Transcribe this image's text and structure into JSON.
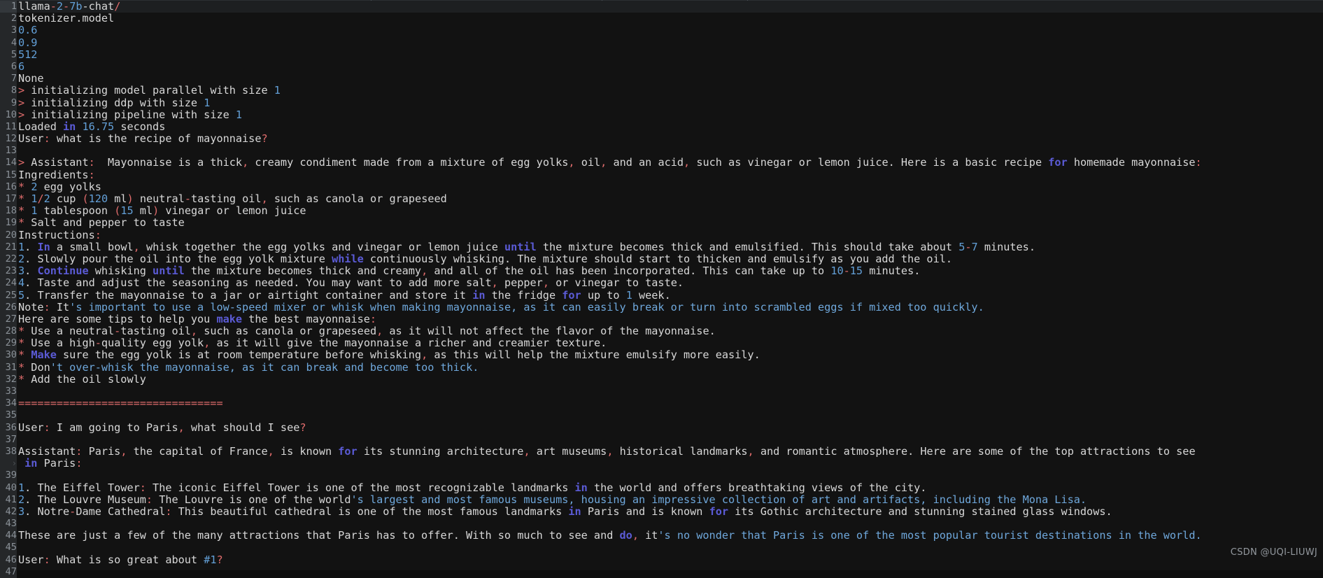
{
  "window": {
    "title": "terminal-output",
    "background_color": "#121212",
    "gutter_color": "#252729",
    "current_line_color": "#1d1f21"
  },
  "colors": {
    "default_text": "#d8d8d8",
    "number": "#63a0d8",
    "string": "#6fa8dc",
    "keyword": "#5b5bd6",
    "operator": "#e06c6c",
    "line_number": "#8b9299"
  },
  "watermark": {
    "text": "CSDN @UQI-LIUWJ"
  },
  "lines": [
    {
      "n": "1",
      "current": true,
      "tokens": [
        {
          "t": "llama",
          "c": "def"
        },
        {
          "t": "-",
          "c": "op"
        },
        {
          "t": "2",
          "c": "num"
        },
        {
          "t": "-",
          "c": "op"
        },
        {
          "t": "7b",
          "c": "num"
        },
        {
          "t": "-chat",
          "c": "def"
        },
        {
          "t": "/",
          "c": "op"
        }
      ]
    },
    {
      "n": "2",
      "tokens": [
        {
          "t": "tokenizer.model",
          "c": "def"
        }
      ]
    },
    {
      "n": "3",
      "tokens": [
        {
          "t": "0.6",
          "c": "num"
        }
      ]
    },
    {
      "n": "4",
      "tokens": [
        {
          "t": "0.9",
          "c": "num"
        }
      ]
    },
    {
      "n": "5",
      "tokens": [
        {
          "t": "512",
          "c": "num"
        }
      ]
    },
    {
      "n": "6",
      "tokens": [
        {
          "t": "6",
          "c": "num"
        }
      ]
    },
    {
      "n": "7",
      "tokens": [
        {
          "t": "None",
          "c": "def"
        }
      ]
    },
    {
      "n": "8",
      "tokens": [
        {
          "t": ">",
          "c": "op"
        },
        {
          "t": " initializing model parallel with size ",
          "c": "def"
        },
        {
          "t": "1",
          "c": "num"
        }
      ]
    },
    {
      "n": "9",
      "tokens": [
        {
          "t": ">",
          "c": "op"
        },
        {
          "t": " initializing ddp with size ",
          "c": "def"
        },
        {
          "t": "1",
          "c": "num"
        }
      ]
    },
    {
      "n": "10",
      "tokens": [
        {
          "t": ">",
          "c": "op"
        },
        {
          "t": " initializing pipeline with size ",
          "c": "def"
        },
        {
          "t": "1",
          "c": "num"
        }
      ]
    },
    {
      "n": "11",
      "tokens": [
        {
          "t": "Loaded ",
          "c": "def"
        },
        {
          "t": "in",
          "c": "kw"
        },
        {
          "t": " ",
          "c": "def"
        },
        {
          "t": "16.75",
          "c": "num"
        },
        {
          "t": " seconds",
          "c": "def"
        }
      ]
    },
    {
      "n": "12",
      "tokens": [
        {
          "t": "User",
          "c": "def"
        },
        {
          "t": ":",
          "c": "op"
        },
        {
          "t": " what is the recipe of mayonnaise",
          "c": "def"
        },
        {
          "t": "?",
          "c": "op"
        }
      ]
    },
    {
      "n": "13",
      "tokens": []
    },
    {
      "n": "14",
      "tokens": [
        {
          "t": ">",
          "c": "op"
        },
        {
          "t": " Assistant",
          "c": "def"
        },
        {
          "t": ":",
          "c": "op"
        },
        {
          "t": "  Mayonnaise is a thick",
          "c": "def"
        },
        {
          "t": ",",
          "c": "op"
        },
        {
          "t": " creamy condiment made from a mixture of egg yolks",
          "c": "def"
        },
        {
          "t": ",",
          "c": "op"
        },
        {
          "t": " oil",
          "c": "def"
        },
        {
          "t": ",",
          "c": "op"
        },
        {
          "t": " and an acid",
          "c": "def"
        },
        {
          "t": ",",
          "c": "op"
        },
        {
          "t": " such as vinegar or lemon juice. Here is a basic recipe ",
          "c": "def"
        },
        {
          "t": "for",
          "c": "kw"
        },
        {
          "t": " homemade mayonnaise",
          "c": "def"
        },
        {
          "t": ":",
          "c": "op"
        }
      ]
    },
    {
      "n": "15",
      "tokens": [
        {
          "t": "Ingredients",
          "c": "def"
        },
        {
          "t": ":",
          "c": "op"
        }
      ]
    },
    {
      "n": "16",
      "tokens": [
        {
          "t": "*",
          "c": "op"
        },
        {
          "t": " ",
          "c": "def"
        },
        {
          "t": "2",
          "c": "num"
        },
        {
          "t": " egg yolks",
          "c": "def"
        }
      ]
    },
    {
      "n": "17",
      "tokens": [
        {
          "t": "*",
          "c": "op"
        },
        {
          "t": " ",
          "c": "def"
        },
        {
          "t": "1",
          "c": "num"
        },
        {
          "t": "/",
          "c": "op"
        },
        {
          "t": "2",
          "c": "num"
        },
        {
          "t": " cup ",
          "c": "def"
        },
        {
          "t": "(",
          "c": "op"
        },
        {
          "t": "120",
          "c": "num"
        },
        {
          "t": " ml",
          "c": "def"
        },
        {
          "t": ")",
          "c": "op"
        },
        {
          "t": " neutral",
          "c": "def"
        },
        {
          "t": "-",
          "c": "op"
        },
        {
          "t": "tasting oil",
          "c": "def"
        },
        {
          "t": ",",
          "c": "op"
        },
        {
          "t": " such as canola or grapeseed",
          "c": "def"
        }
      ]
    },
    {
      "n": "18",
      "tokens": [
        {
          "t": "*",
          "c": "op"
        },
        {
          "t": " ",
          "c": "def"
        },
        {
          "t": "1",
          "c": "num"
        },
        {
          "t": " tablespoon ",
          "c": "def"
        },
        {
          "t": "(",
          "c": "op"
        },
        {
          "t": "15",
          "c": "num"
        },
        {
          "t": " ml",
          "c": "def"
        },
        {
          "t": ")",
          "c": "op"
        },
        {
          "t": " vinegar or lemon juice",
          "c": "def"
        }
      ]
    },
    {
      "n": "19",
      "tokens": [
        {
          "t": "*",
          "c": "op"
        },
        {
          "t": " Salt and pepper to taste",
          "c": "def"
        }
      ]
    },
    {
      "n": "20",
      "tokens": [
        {
          "t": "Instructions",
          "c": "def"
        },
        {
          "t": ":",
          "c": "op"
        }
      ]
    },
    {
      "n": "21",
      "tokens": [
        {
          "t": "1",
          "c": "num"
        },
        {
          "t": ".",
          "c": "def"
        },
        {
          "t": " ",
          "c": "def"
        },
        {
          "t": "In",
          "c": "kw"
        },
        {
          "t": " a small bowl",
          "c": "def"
        },
        {
          "t": ",",
          "c": "op"
        },
        {
          "t": " whisk together the egg yolks and vinegar or lemon juice ",
          "c": "def"
        },
        {
          "t": "until",
          "c": "kw"
        },
        {
          "t": " the mixture becomes thick and emulsified. This should take about ",
          "c": "def"
        },
        {
          "t": "5",
          "c": "num"
        },
        {
          "t": "-",
          "c": "op"
        },
        {
          "t": "7",
          "c": "num"
        },
        {
          "t": " minutes.",
          "c": "def"
        }
      ]
    },
    {
      "n": "22",
      "tokens": [
        {
          "t": "2",
          "c": "num"
        },
        {
          "t": ". Slowly pour the oil into the egg yolk mixture ",
          "c": "def"
        },
        {
          "t": "while",
          "c": "kw"
        },
        {
          "t": " continuously whisking. The mixture should start to thicken and emulsify as you add the oil.",
          "c": "def"
        }
      ]
    },
    {
      "n": "23",
      "tokens": [
        {
          "t": "3",
          "c": "num"
        },
        {
          "t": ". ",
          "c": "def"
        },
        {
          "t": "Continue",
          "c": "kw"
        },
        {
          "t": " whisking ",
          "c": "def"
        },
        {
          "t": "until",
          "c": "kw"
        },
        {
          "t": " the mixture becomes thick and creamy",
          "c": "def"
        },
        {
          "t": ",",
          "c": "op"
        },
        {
          "t": " and all of the oil has been incorporated. This can take up to ",
          "c": "def"
        },
        {
          "t": "10",
          "c": "num"
        },
        {
          "t": "-",
          "c": "op"
        },
        {
          "t": "15",
          "c": "num"
        },
        {
          "t": " minutes.",
          "c": "def"
        }
      ]
    },
    {
      "n": "24",
      "tokens": [
        {
          "t": "4",
          "c": "num"
        },
        {
          "t": ". Taste and adjust the seasoning as needed. You may want to add more salt",
          "c": "def"
        },
        {
          "t": ",",
          "c": "op"
        },
        {
          "t": " pepper",
          "c": "def"
        },
        {
          "t": ",",
          "c": "op"
        },
        {
          "t": " or vinegar to taste.",
          "c": "def"
        }
      ]
    },
    {
      "n": "25",
      "tokens": [
        {
          "t": "5",
          "c": "num"
        },
        {
          "t": ". Transfer the mayonnaise to a jar or airtight container and store it ",
          "c": "def"
        },
        {
          "t": "in",
          "c": "kw"
        },
        {
          "t": " the fridge ",
          "c": "def"
        },
        {
          "t": "for",
          "c": "kw"
        },
        {
          "t": " up to ",
          "c": "def"
        },
        {
          "t": "1",
          "c": "num"
        },
        {
          "t": " week.",
          "c": "def"
        }
      ]
    },
    {
      "n": "26",
      "tokens": [
        {
          "t": "Note",
          "c": "def"
        },
        {
          "t": ":",
          "c": "op"
        },
        {
          "t": " It",
          "c": "def"
        },
        {
          "t": "'s important to use a low-speed mixer or whisk when making mayonnaise, as it can easily break or turn into scrambled eggs if mixed too quickly.",
          "c": "str"
        }
      ]
    },
    {
      "n": "27",
      "tokens": [
        {
          "t": "Here are some tips to help you ",
          "c": "def"
        },
        {
          "t": "make",
          "c": "kw"
        },
        {
          "t": " the best mayonnaise",
          "c": "def"
        },
        {
          "t": ":",
          "c": "op"
        }
      ]
    },
    {
      "n": "28",
      "tokens": [
        {
          "t": "*",
          "c": "op"
        },
        {
          "t": " Use a neutral",
          "c": "def"
        },
        {
          "t": "-",
          "c": "op"
        },
        {
          "t": "tasting oil",
          "c": "def"
        },
        {
          "t": ",",
          "c": "op"
        },
        {
          "t": " such as canola or grapeseed",
          "c": "def"
        },
        {
          "t": ",",
          "c": "op"
        },
        {
          "t": " as it will not affect the flavor of the mayonnaise.",
          "c": "def"
        }
      ]
    },
    {
      "n": "29",
      "tokens": [
        {
          "t": "*",
          "c": "op"
        },
        {
          "t": " Use a high",
          "c": "def"
        },
        {
          "t": "-",
          "c": "op"
        },
        {
          "t": "quality egg yolk",
          "c": "def"
        },
        {
          "t": ",",
          "c": "op"
        },
        {
          "t": " as it will give the mayonnaise a richer and creamier texture.",
          "c": "def"
        }
      ]
    },
    {
      "n": "30",
      "tokens": [
        {
          "t": "*",
          "c": "op"
        },
        {
          "t": " ",
          "c": "def"
        },
        {
          "t": "Make",
          "c": "kw"
        },
        {
          "t": " sure the egg yolk is at room temperature before whisking",
          "c": "def"
        },
        {
          "t": ",",
          "c": "op"
        },
        {
          "t": " as this will help the mixture emulsify more easily.",
          "c": "def"
        }
      ]
    },
    {
      "n": "31",
      "tokens": [
        {
          "t": "*",
          "c": "op"
        },
        {
          "t": " Don",
          "c": "def"
        },
        {
          "t": "'t over-whisk the mayonnaise, as it can break and become too thick.",
          "c": "str"
        }
      ]
    },
    {
      "n": "32",
      "tokens": [
        {
          "t": "*",
          "c": "op"
        },
        {
          "t": " Add the oil slowly",
          "c": "def"
        }
      ]
    },
    {
      "n": "33",
      "tokens": []
    },
    {
      "n": "34",
      "tokens": [
        {
          "t": "================================",
          "c": "op"
        }
      ]
    },
    {
      "n": "35",
      "tokens": []
    },
    {
      "n": "36",
      "tokens": [
        {
          "t": "User",
          "c": "def"
        },
        {
          "t": ":",
          "c": "op"
        },
        {
          "t": " I am going to Paris",
          "c": "def"
        },
        {
          "t": ",",
          "c": "op"
        },
        {
          "t": " what should I see",
          "c": "def"
        },
        {
          "t": "?",
          "c": "op"
        }
      ]
    },
    {
      "n": "37",
      "tokens": []
    },
    {
      "n": "38",
      "tokens": [
        {
          "t": "Assistant",
          "c": "def"
        },
        {
          "t": ":",
          "c": "op"
        },
        {
          "t": " Paris",
          "c": "def"
        },
        {
          "t": ",",
          "c": "op"
        },
        {
          "t": " the capital of France",
          "c": "def"
        },
        {
          "t": ",",
          "c": "op"
        },
        {
          "t": " is known ",
          "c": "def"
        },
        {
          "t": "for",
          "c": "kw"
        },
        {
          "t": " its stunning architecture",
          "c": "def"
        },
        {
          "t": ",",
          "c": "op"
        },
        {
          "t": " art museums",
          "c": "def"
        },
        {
          "t": ",",
          "c": "op"
        },
        {
          "t": " historical landmarks",
          "c": "def"
        },
        {
          "t": ",",
          "c": "op"
        },
        {
          "t": " and romantic atmosphere. Here are some of the top attractions to see",
          "c": "def"
        }
      ]
    },
    {
      "n": "",
      "wrap": true,
      "tokens": [
        {
          "t": " ",
          "c": "def"
        },
        {
          "t": "in",
          "c": "kw"
        },
        {
          "t": " Paris",
          "c": "def"
        },
        {
          "t": ":",
          "c": "op"
        }
      ]
    },
    {
      "n": "39",
      "tokens": []
    },
    {
      "n": "40",
      "tokens": [
        {
          "t": "1",
          "c": "num"
        },
        {
          "t": ". The Eiffel Tower",
          "c": "def"
        },
        {
          "t": ":",
          "c": "op"
        },
        {
          "t": " The iconic Eiffel Tower is one of the most recognizable landmarks ",
          "c": "def"
        },
        {
          "t": "in",
          "c": "kw"
        },
        {
          "t": " the world and offers breathtaking views of the city.",
          "c": "def"
        }
      ]
    },
    {
      "n": "41",
      "tokens": [
        {
          "t": "2",
          "c": "num"
        },
        {
          "t": ". The Louvre Museum",
          "c": "def"
        },
        {
          "t": ":",
          "c": "op"
        },
        {
          "t": " The Louvre is one of the world",
          "c": "def"
        },
        {
          "t": "'s largest and most famous museums, housing an impressive collection of art and artifacts, including the Mona Lisa.",
          "c": "str"
        }
      ]
    },
    {
      "n": "42",
      "tokens": [
        {
          "t": "3",
          "c": "num"
        },
        {
          "t": ". Notre",
          "c": "def"
        },
        {
          "t": "-",
          "c": "op"
        },
        {
          "t": "Dame Cathedral",
          "c": "def"
        },
        {
          "t": ":",
          "c": "op"
        },
        {
          "t": " This beautiful cathedral is one of the most famous landmarks ",
          "c": "def"
        },
        {
          "t": "in",
          "c": "kw"
        },
        {
          "t": " Paris and is known ",
          "c": "def"
        },
        {
          "t": "for",
          "c": "kw"
        },
        {
          "t": " its Gothic architecture and stunning stained glass windows.",
          "c": "def"
        }
      ]
    },
    {
      "n": "43",
      "tokens": []
    },
    {
      "n": "44",
      "tokens": [
        {
          "t": "These are just a few of the many attractions that Paris has to offer. With so much to see and ",
          "c": "def"
        },
        {
          "t": "do",
          "c": "kw"
        },
        {
          "t": ",",
          "c": "op"
        },
        {
          "t": " it",
          "c": "def"
        },
        {
          "t": "'s no wonder that Paris is one of the most popular tourist destinations in the world.",
          "c": "str"
        }
      ]
    },
    {
      "n": "45",
      "tokens": []
    },
    {
      "n": "46",
      "tokens": [
        {
          "t": "User",
          "c": "def"
        },
        {
          "t": ":",
          "c": "op"
        },
        {
          "t": " What is so great about ",
          "c": "def"
        },
        {
          "t": "#1",
          "c": "num"
        },
        {
          "t": "?",
          "c": "op"
        }
      ]
    },
    {
      "n": "47",
      "tokens": []
    }
  ]
}
